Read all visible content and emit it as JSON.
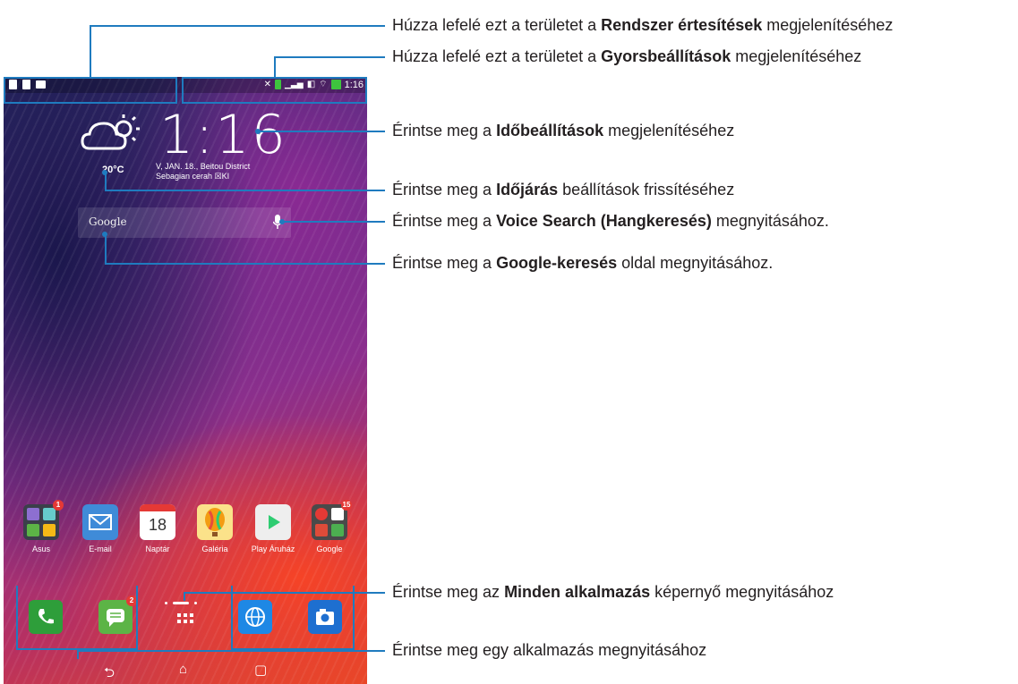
{
  "phone": {
    "status_time": "1:16",
    "clock": "1:16",
    "date_line1": "V, JAN. 18., Beitou District",
    "date_line2": "Sebagian cerah  ☒KI",
    "temperature": "20°C",
    "search_placeholder": "Google",
    "apps": [
      {
        "label": "Asus",
        "badge": "1",
        "color": "#3b3f4a",
        "icon": "folder-icon"
      },
      {
        "label": "E-mail",
        "badge": "",
        "color": "#3f8bd8",
        "icon": "mail-icon"
      },
      {
        "label": "Naptár",
        "badge": "",
        "color": "#ffffff",
        "icon": "calendar-icon",
        "day": "18"
      },
      {
        "label": "Galéria",
        "badge": "",
        "color": "#f4d34a",
        "icon": "balloon-icon"
      },
      {
        "label": "Play Áruház",
        "badge": "",
        "color": "#eeeeee",
        "icon": "play-store-icon"
      },
      {
        "label": "Google",
        "badge": "15",
        "color": "#4a4a4a",
        "icon": "google-folder-icon"
      }
    ],
    "dock": [
      {
        "name": "phone-icon",
        "color": "#2e9e3a",
        "badge": ""
      },
      {
        "name": "messages-icon",
        "color": "#5cb446",
        "badge": "2"
      },
      {
        "name": "all-apps-icon",
        "color": "",
        "badge": ""
      },
      {
        "name": "browser-icon",
        "color": "#1e88e5",
        "badge": ""
      },
      {
        "name": "camera-icon",
        "color": "#1e6fd0",
        "badge": ""
      }
    ],
    "nav": {
      "back": "⮌",
      "home": "⌂",
      "recents": "▢"
    }
  },
  "callouts": [
    {
      "pre": "Húzza lefelé ezt a területet a ",
      "bold": "Rendszer értesítések",
      "post": " megjelenítéséhez"
    },
    {
      "pre": "Húzza lefelé ezt a területet a ",
      "bold": "Gyorsbeállítások",
      "post": " megjelenítéséhez"
    },
    {
      "pre": "Érintse meg a ",
      "bold": "Időbeállítások",
      "post": " megjelenítéséhez"
    },
    {
      "pre": "Érintse meg a ",
      "bold": "Időjárás",
      "post": " beállítások frissítéséhez"
    },
    {
      "pre": "Érintse meg a ",
      "bold": "Voice Search (Hangkeresés)",
      "post": " megnyitásához."
    },
    {
      "pre": "Érintse meg a ",
      "bold": "Google-keresés",
      "post": " oldal megnyitásához."
    },
    {
      "pre": "Érintse meg az ",
      "bold": "Minden alkalmazás",
      "post": " képernyő megnyitásához"
    },
    {
      "pre": "Érintse meg egy alkalmazás megnyitásához",
      "bold": "",
      "post": ""
    }
  ],
  "accent_color": "#1f7bbf"
}
